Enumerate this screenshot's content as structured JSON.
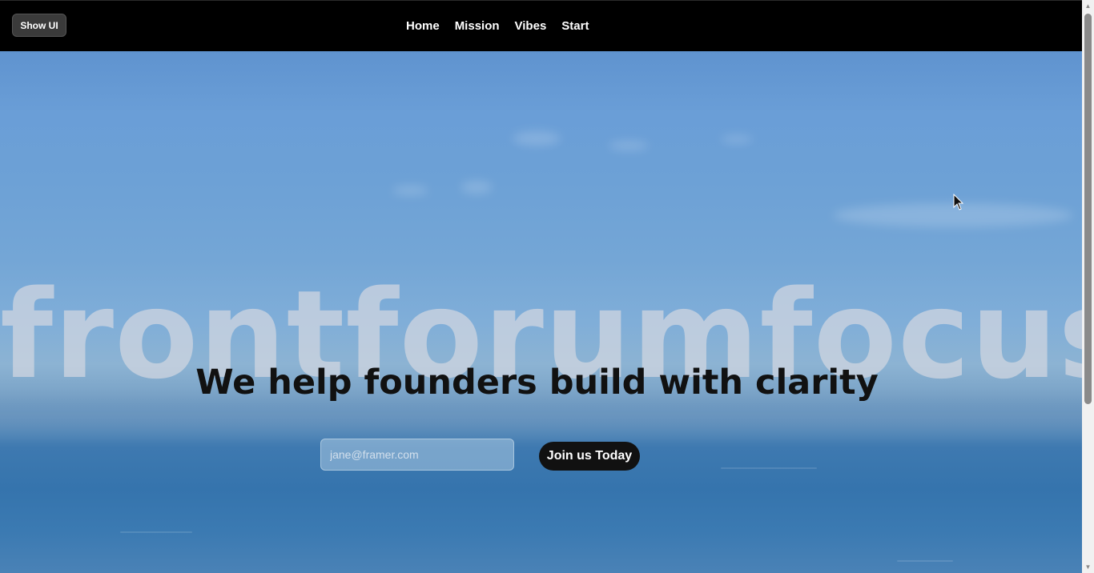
{
  "header": {
    "show_ui_label": "Show UI",
    "nav": [
      {
        "label": "Home"
      },
      {
        "label": "Mission"
      },
      {
        "label": "Vibes"
      },
      {
        "label": "Start"
      }
    ]
  },
  "hero": {
    "brand": "frontforumfocus",
    "tagline": "We help founders build with clarity",
    "email_placeholder": "jane@framer.com",
    "cta_label": "Join us Today"
  },
  "colors": {
    "topbar": "#000000",
    "sky": "#6da1d6",
    "sea": "#3574ad",
    "cta": "#111111"
  },
  "icons": {
    "scroll_up": "triangle-up",
    "scroll_down": "triangle-down",
    "cursor": "arrow-pointer"
  }
}
